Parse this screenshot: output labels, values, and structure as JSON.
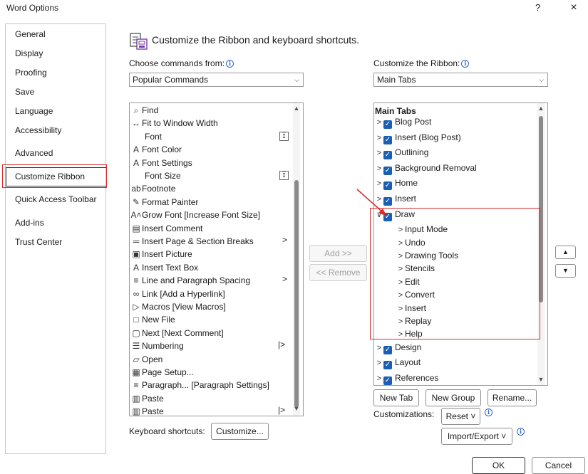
{
  "window": {
    "title": "Word Options",
    "help_label": "?",
    "close_label": "×"
  },
  "nav": {
    "items": [
      {
        "label": "General"
      },
      {
        "label": "Display"
      },
      {
        "label": "Proofing"
      },
      {
        "label": "Save"
      },
      {
        "label": "Language"
      },
      {
        "label": "Accessibility"
      },
      {
        "label": "Advanced"
      },
      {
        "label": "Customize Ribbon",
        "selected": true
      },
      {
        "label": "Quick Access Toolbar"
      },
      {
        "label": "Add-ins"
      },
      {
        "label": "Trust Center"
      }
    ]
  },
  "header": {
    "title": "Customize the Ribbon and keyboard shortcuts.",
    "icon": "customize-ribbon-icon"
  },
  "commands": {
    "label": "Choose commands from:",
    "selected": "Popular Commands",
    "items": [
      {
        "label": "Find",
        "icon": "find-icon",
        "glyph": "⌕"
      },
      {
        "label": "Fit to Window Width",
        "icon": "fit-width-icon",
        "glyph": "↔"
      },
      {
        "label": "Font",
        "icon": "",
        "glyph": "",
        "side": "I̅"
      },
      {
        "label": "Font Color",
        "icon": "font-color-icon",
        "glyph": "A"
      },
      {
        "label": "Font Settings",
        "icon": "font-settings-icon",
        "glyph": "A"
      },
      {
        "label": "Font Size",
        "icon": "",
        "glyph": "",
        "side": "I̅"
      },
      {
        "label": "Footnote",
        "icon": "footnote-icon",
        "glyph": "ab"
      },
      {
        "label": "Format Painter",
        "icon": "format-painter-icon",
        "glyph": "✎"
      },
      {
        "label": "Grow Font [Increase Font Size]",
        "icon": "grow-font-icon",
        "glyph": "A˄"
      },
      {
        "label": "Insert Comment",
        "icon": "insert-comment-icon",
        "glyph": "▤"
      },
      {
        "label": "Insert Page & Section Breaks",
        "icon": "page-break-icon",
        "glyph": "═",
        "arrow": ">"
      },
      {
        "label": "Insert Picture",
        "icon": "insert-picture-icon",
        "glyph": "▣"
      },
      {
        "label": "Insert Text Box",
        "icon": "text-box-icon",
        "glyph": "A"
      },
      {
        "label": "Line and Paragraph Spacing",
        "icon": "line-spacing-icon",
        "glyph": "≡",
        "arrow": ">"
      },
      {
        "label": "Link [Add a Hyperlink]",
        "icon": "link-icon",
        "glyph": "∞"
      },
      {
        "label": "Macros [View Macros]",
        "icon": "macros-icon",
        "glyph": "▷"
      },
      {
        "label": "New File",
        "icon": "new-file-icon",
        "glyph": "□"
      },
      {
        "label": "Next [Next Comment]",
        "icon": "next-comment-icon",
        "glyph": "▢"
      },
      {
        "label": "Numbering",
        "icon": "numbering-icon",
        "glyph": "☰",
        "arrow": "|>"
      },
      {
        "label": "Open",
        "icon": "open-folder-icon",
        "glyph": "▱"
      },
      {
        "label": "Page Setup...",
        "icon": "page-setup-icon",
        "glyph": "▦"
      },
      {
        "label": "Paragraph... [Paragraph Settings]",
        "icon": "paragraph-icon",
        "glyph": "≡"
      },
      {
        "label": "Paste",
        "icon": "paste-icon",
        "glyph": "▥"
      },
      {
        "label": "Paste",
        "icon": "paste-icon",
        "glyph": "▥",
        "arrow": "|>"
      }
    ]
  },
  "ribbon": {
    "label": "Customize the Ribbon:",
    "selected": "Main Tabs",
    "header": "Main Tabs",
    "items": [
      {
        "label": "Blog Post",
        "level": 0,
        "expanded": false
      },
      {
        "label": "Insert (Blog Post)",
        "level": 0,
        "expanded": false
      },
      {
        "label": "Outlining",
        "level": 0,
        "expanded": false
      },
      {
        "label": "Background Removal",
        "level": 0,
        "expanded": false
      },
      {
        "label": "Home",
        "level": 0,
        "expanded": false
      },
      {
        "label": "Insert",
        "level": 0,
        "expanded": false
      },
      {
        "label": "Draw",
        "level": 0,
        "expanded": true,
        "selected": true
      },
      {
        "label": "Input Mode",
        "level": 1
      },
      {
        "label": "Undo",
        "level": 1
      },
      {
        "label": "Drawing Tools",
        "level": 1
      },
      {
        "label": "Stencils",
        "level": 1
      },
      {
        "label": "Edit",
        "level": 1
      },
      {
        "label": "Convert",
        "level": 1
      },
      {
        "label": "Insert",
        "level": 1
      },
      {
        "label": "Replay",
        "level": 1
      },
      {
        "label": "Help",
        "level": 1
      },
      {
        "label": "Design",
        "level": 0,
        "expanded": false
      },
      {
        "label": "Layout",
        "level": 0,
        "expanded": false
      },
      {
        "label": "References",
        "level": 0,
        "expanded": false
      }
    ]
  },
  "buttons": {
    "add": "Add >>",
    "remove": "<< Remove",
    "new_tab": "New Tab",
    "new_group": "New Group",
    "rename": "Rename...",
    "customizations_label": "Customizations:",
    "reset": "Reset ˅",
    "import_export": "Import/Export ˅",
    "keyboard_label": "Keyboard shortcuts:",
    "customize": "Customize...",
    "ok": "OK",
    "cancel": "Cancel",
    "move_up": "▲",
    "move_down": "▼"
  },
  "colors": {
    "highlight_red": "#d92c2c",
    "checkbox_blue": "#1a5fb4"
  }
}
